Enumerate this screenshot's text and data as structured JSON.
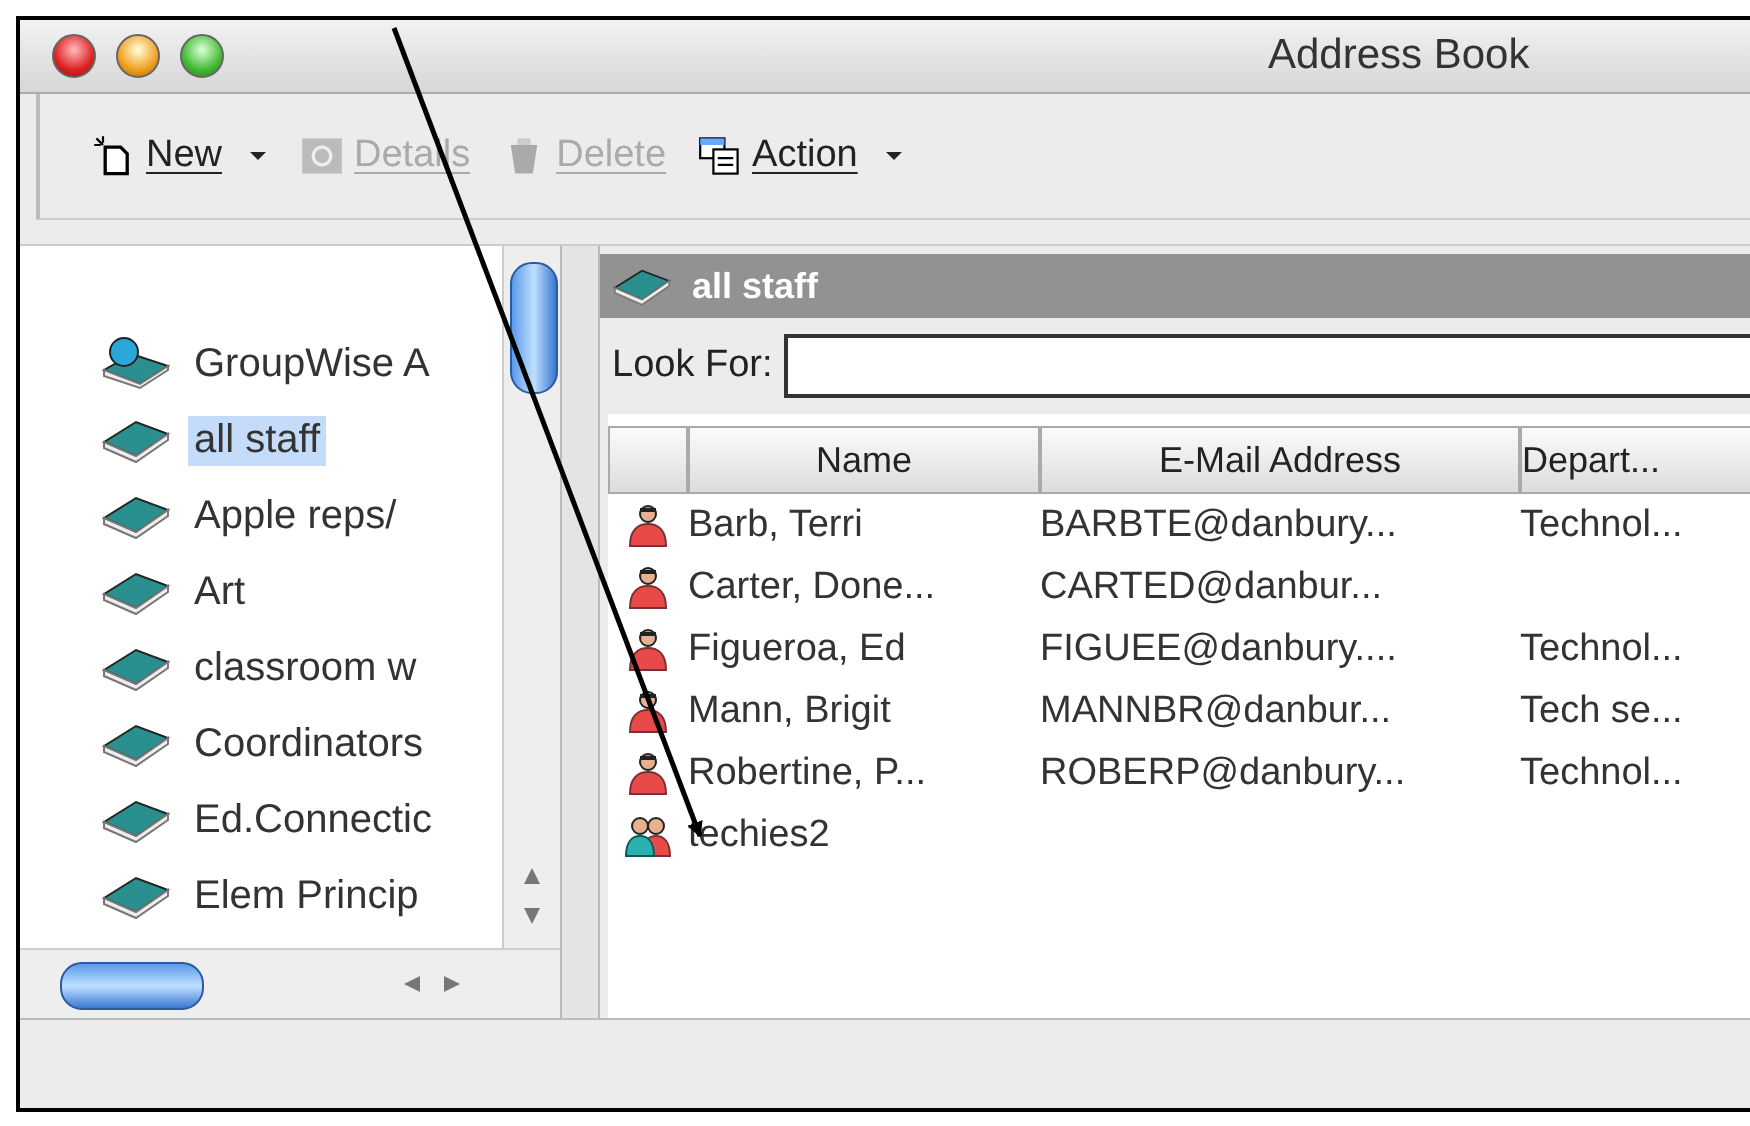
{
  "window": {
    "title": "Address Book"
  },
  "toolbar": [
    {
      "label": "New",
      "kind": "new",
      "disabled": false,
      "menu": true
    },
    {
      "label": "Details",
      "kind": "details",
      "disabled": true,
      "menu": false
    },
    {
      "label": "Delete",
      "kind": "delete",
      "disabled": true,
      "menu": false
    },
    {
      "label": "Action",
      "kind": "action",
      "disabled": false,
      "menu": true
    }
  ],
  "sidebar": {
    "items": [
      {
        "label": "GroupWise A",
        "kind": "system",
        "selected": false
      },
      {
        "label": "all staff",
        "kind": "book",
        "selected": true
      },
      {
        "label": "Apple reps/",
        "kind": "book",
        "selected": false
      },
      {
        "label": "Art",
        "kind": "book",
        "selected": false
      },
      {
        "label": "classroom w",
        "kind": "book",
        "selected": false
      },
      {
        "label": "Coordinators",
        "kind": "book",
        "selected": false
      },
      {
        "label": "Ed.Connectic",
        "kind": "book",
        "selected": false
      },
      {
        "label": "Elem Princip",
        "kind": "book",
        "selected": false
      }
    ]
  },
  "book_header": {
    "title": "all staff"
  },
  "search": {
    "label": "Look For:"
  },
  "table": {
    "columns": [
      "Name",
      "E-Mail Address",
      "Depart..."
    ],
    "rows": [
      {
        "kind": "person",
        "cells": [
          "Barb, Terri",
          "BARBTE@danbury...",
          "Technol..."
        ]
      },
      {
        "kind": "person",
        "cells": [
          "Carter, Done...",
          "CARTED@danbur...",
          ""
        ]
      },
      {
        "kind": "person",
        "cells": [
          "Figueroa, Ed",
          "FIGUEE@danbury....",
          "Technol..."
        ]
      },
      {
        "kind": "person",
        "cells": [
          "Mann, Brigit",
          "MANNBR@danbur...",
          "Tech se..."
        ]
      },
      {
        "kind": "person",
        "cells": [
          "Robertine, P...",
          "ROBERP@danbury...",
          "Technol..."
        ]
      },
      {
        "kind": "group",
        "cells": [
          "techies2",
          "",
          ""
        ]
      }
    ]
  }
}
